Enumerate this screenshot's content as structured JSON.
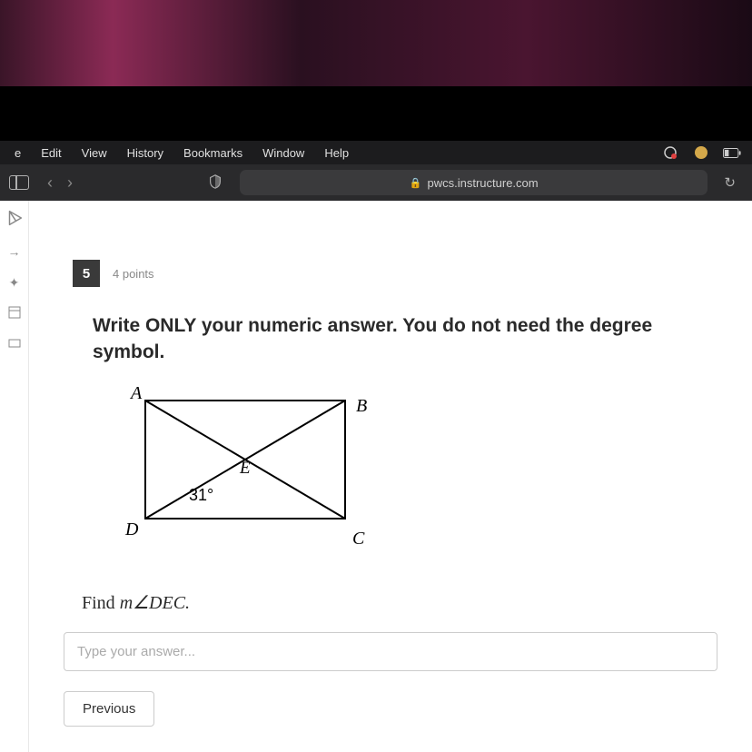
{
  "menubar": {
    "items": [
      "e",
      "Edit",
      "View",
      "History",
      "Bookmarks",
      "Window",
      "Help"
    ]
  },
  "toolbar": {
    "url": "pwcs.instructure.com"
  },
  "question": {
    "number": "5",
    "points": "4 points",
    "instruction": "Write ONLY your numeric answer. You do not need the degree symbol.",
    "prompt_prefix": "Find ",
    "prompt_math": "m∠DEC.",
    "labels": {
      "A": "A",
      "B": "B",
      "C": "C",
      "D": "D",
      "E": "E",
      "angle": "31°"
    },
    "placeholder": "Type your answer..."
  },
  "nav": {
    "previous": "Previous"
  }
}
